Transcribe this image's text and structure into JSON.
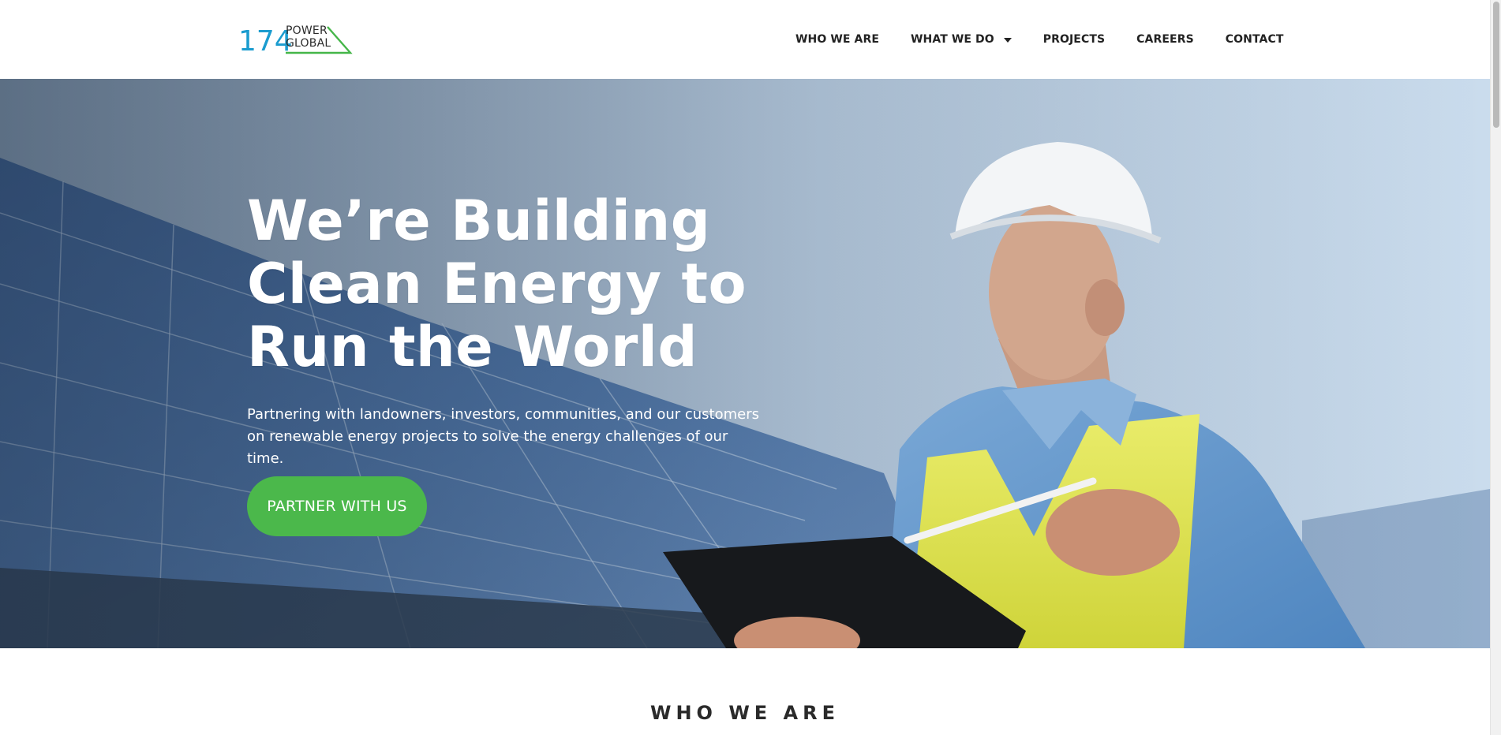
{
  "header": {
    "logo": {
      "number": "174",
      "line1": "POWER",
      "line2": "GLOBAL",
      "colors": {
        "number": "#1b9ccf",
        "triangle": "#45b649"
      }
    },
    "nav": [
      {
        "label": "WHO WE ARE"
      },
      {
        "label": "WHAT WE DO",
        "icon": "caret-down-icon"
      },
      {
        "label": "PROJECTS"
      },
      {
        "label": "CAREERS"
      },
      {
        "label": "CONTACT"
      }
    ]
  },
  "hero": {
    "title": "We’re Building\nClean Energy to\nRun the World",
    "subtitle": "Partnering with landowners, investors, communities, and our customers on renewable energy projects to solve the energy challenges of our time.",
    "cta_label": "PARTNER WITH US",
    "image": "solar-engineer-photo",
    "colors": {
      "cta": "#4bb84b",
      "text": "#ffffff"
    }
  },
  "sections": {
    "who_we_are_heading": "WHO WE ARE"
  }
}
